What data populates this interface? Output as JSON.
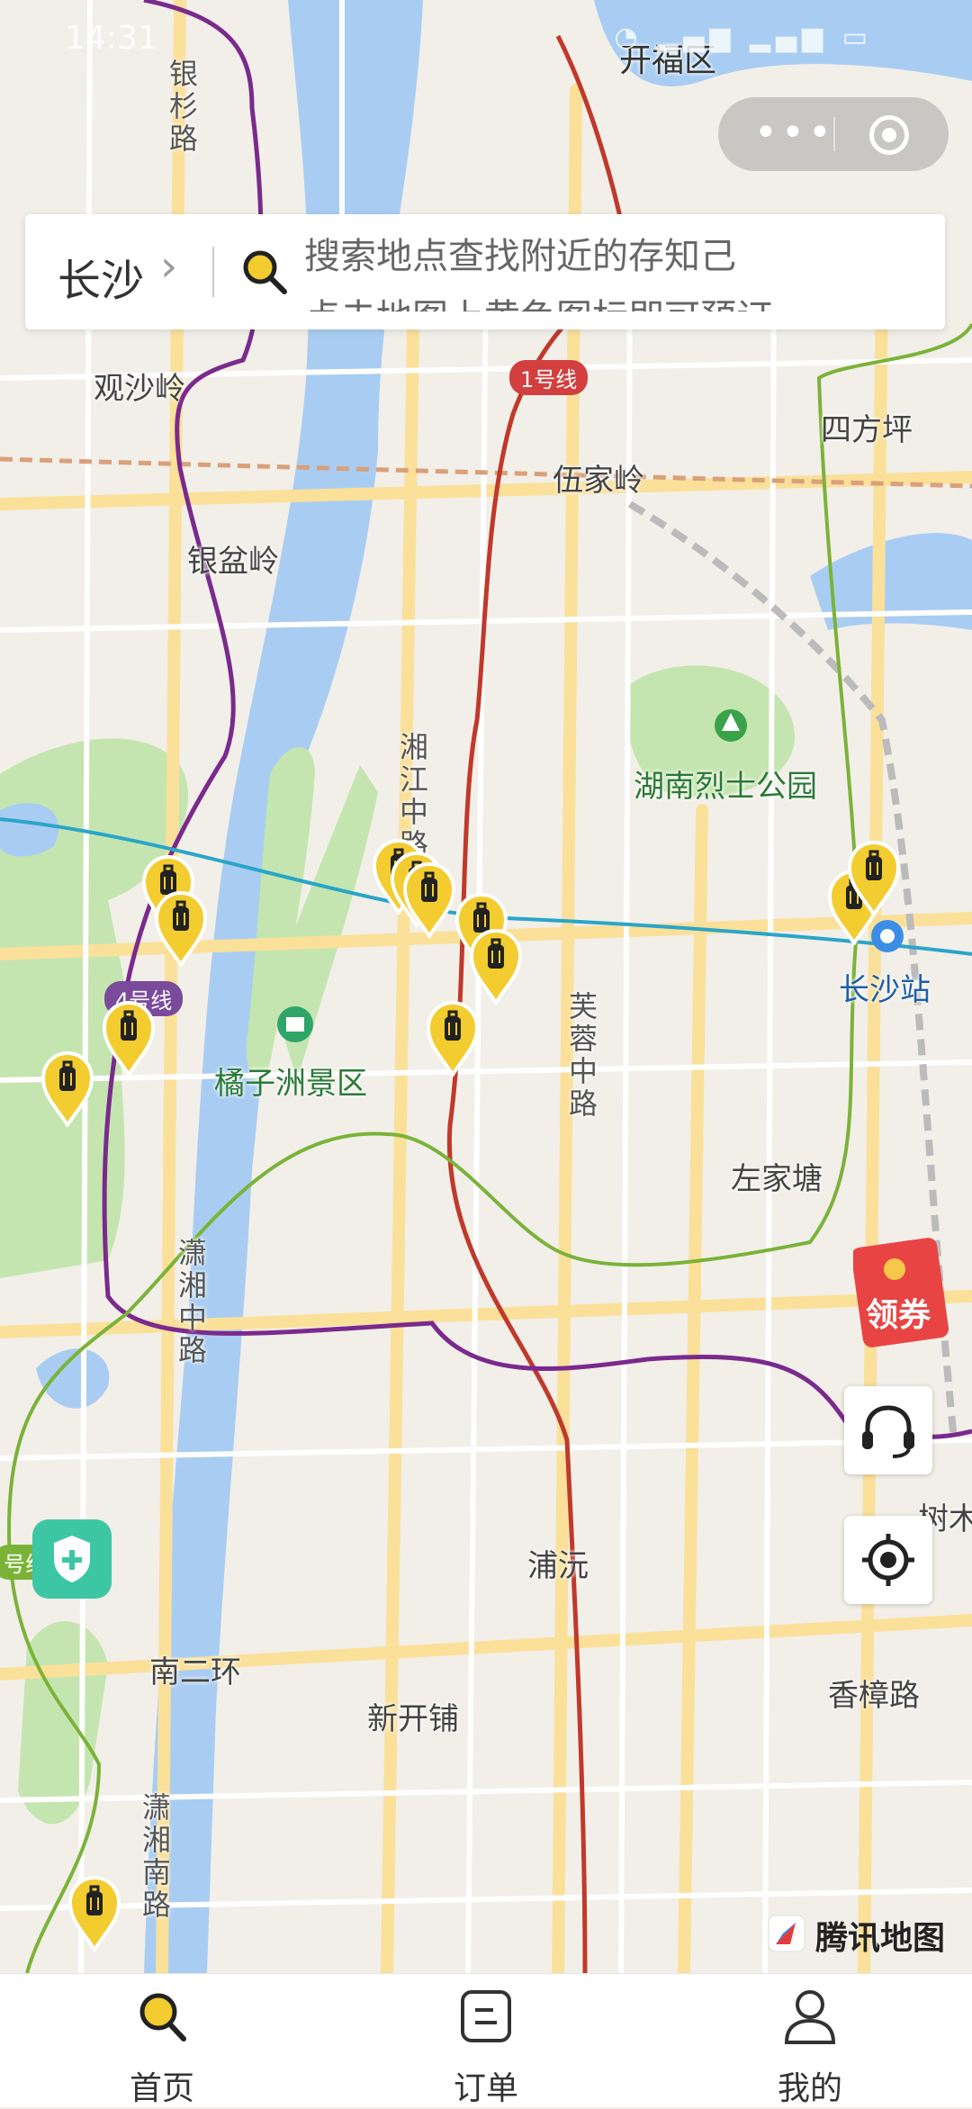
{
  "status_bar": {
    "time": "14:31"
  },
  "search": {
    "city": "长沙",
    "hint_line1": "搜索地点查找附近的存知己",
    "hint_line2": "点击地图上黄色图标即可预订"
  },
  "map": {
    "labels": [
      {
        "text": "开福区"
      },
      {
        "text": "观沙岭"
      },
      {
        "text": "四方坪"
      },
      {
        "text": "伍家岭"
      },
      {
        "text": "银盆岭"
      },
      {
        "text": "湖南烈士公园"
      },
      {
        "text": "长沙站"
      },
      {
        "text": "橘子洲景区"
      },
      {
        "text": "左家塘"
      },
      {
        "text": "树木"
      },
      {
        "text": "浦沅"
      },
      {
        "text": "南二环"
      },
      {
        "text": "新开铺"
      },
      {
        "text": "香樟路"
      }
    ],
    "vertical_labels": [
      {
        "text": "银杉路"
      },
      {
        "text": "湘江中路"
      },
      {
        "text": "芙蓉中路"
      },
      {
        "text": "潇湘中路"
      },
      {
        "text": "潇湘南路"
      }
    ],
    "metro_badges": [
      {
        "text": "1号线",
        "color": "#d33f3f"
      },
      {
        "text": "4号线",
        "color": "#7a4a9b"
      },
      {
        "text": "号线",
        "color": "#7ab338"
      }
    ],
    "pin_count": 13,
    "colors": {
      "water": "#a9cdf2",
      "park": "#c5e5b0",
      "road": "#fbe09a",
      "pin": "#f3cc2f"
    }
  },
  "coupon": {
    "label": "领券",
    "color": "#e84444"
  },
  "brand": {
    "text": "腾讯地图"
  },
  "tabs": [
    {
      "label": "首页",
      "icon": "search-icon"
    },
    {
      "label": "订单",
      "icon": "order-icon"
    },
    {
      "label": "我的",
      "icon": "profile-icon"
    }
  ]
}
